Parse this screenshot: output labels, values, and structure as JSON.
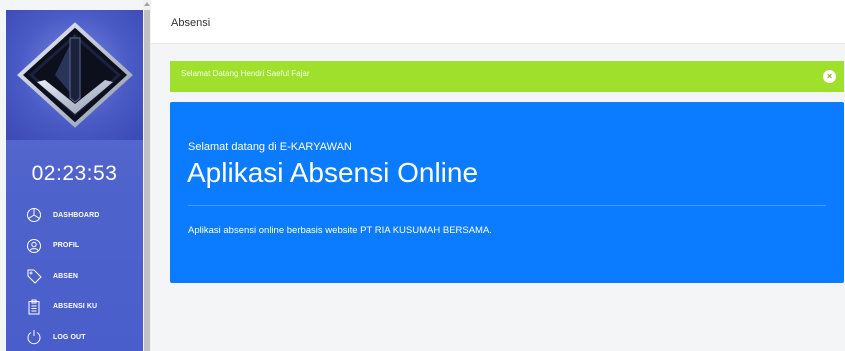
{
  "sidebar": {
    "clock": "02:23:53",
    "items": [
      {
        "label": "DASHBOARD",
        "icon": "dashboard-icon"
      },
      {
        "label": "PROFIL",
        "icon": "profile-icon"
      },
      {
        "label": "ABSEN",
        "icon": "tag-icon"
      },
      {
        "label": "ABSENSI KU",
        "icon": "clipboard-icon"
      },
      {
        "label": "LOG OUT",
        "icon": "power-icon"
      }
    ]
  },
  "header": {
    "title": "Absensi"
  },
  "alert": {
    "message": "Selamat Datang Hendri Saeful Fajar",
    "close_glyph": "×",
    "color": "#9ee02b"
  },
  "jumbotron": {
    "subtitle": "Selamat datang di E-KARYAWAN",
    "title": "Aplikasi Absensi Online",
    "description": "Aplikasi absensi online berbasis website PT RIA KUSUMAH BERSAMA.",
    "color": "#0b7bff"
  },
  "colors": {
    "sidebar": "#4f63cc",
    "accent": "#0b7bff",
    "success": "#9ee02b"
  }
}
